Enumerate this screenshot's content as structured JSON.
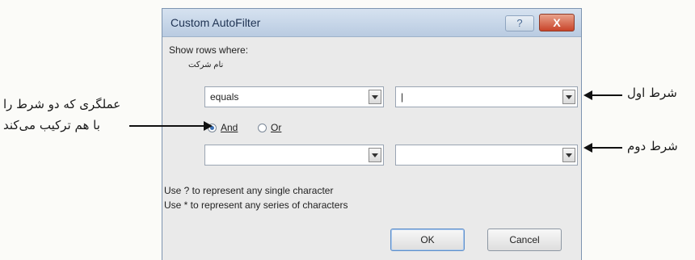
{
  "dialog": {
    "title": "Custom AutoFilter",
    "help_label": "?",
    "close_label": "X",
    "show_rows_label": "Show rows where:",
    "column_name": "نام شرکت",
    "condition1": {
      "operator": "equals",
      "value": "|"
    },
    "condition2": {
      "operator": "",
      "value": ""
    },
    "logic": {
      "and_label": "And",
      "or_label": "Or",
      "selected": "And"
    },
    "hint1": "Use ? to represent any single character",
    "hint2": "Use * to represent any series of characters",
    "ok_label": "OK",
    "cancel_label": "Cancel"
  },
  "annotations": {
    "first_condition": "شرط اول",
    "second_condition": "شرط دوم",
    "operator_line1": "عملگری که دو شرط را",
    "operator_line2": "با هم ترکیب می‌کند"
  }
}
